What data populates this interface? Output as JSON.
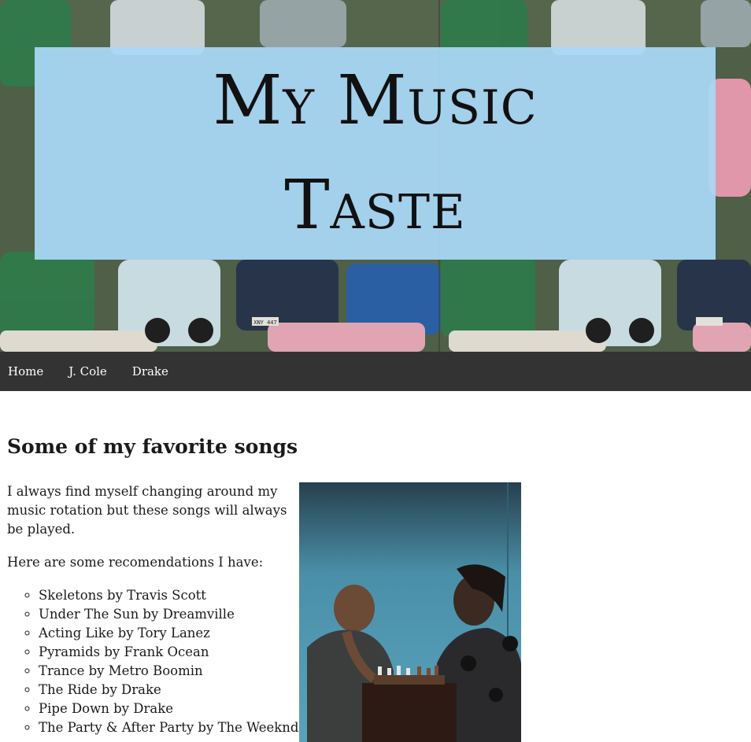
{
  "hero": {
    "title_line1": "My Music",
    "title_line2": "Taste",
    "plate_text": "XNY 447"
  },
  "nav": {
    "items": [
      {
        "label": "Home"
      },
      {
        "label": "J. Cole"
      },
      {
        "label": "Drake"
      }
    ]
  },
  "main": {
    "heading": "Some of my favorite songs",
    "intro": "I always find myself changing around my music rotation but these songs will always be played.",
    "recs_intro": "Here are some recomendations I have:",
    "songs": [
      "Skeletons by Travis Scott",
      "Under The Sun by Dreamville",
      "Acting Like by Tory Lanez",
      "Pyramids by Frank Ocean",
      "Trance by Metro Boomin",
      "The Ride by Drake",
      "Pipe Down by Drake",
      "The Party & After Party by The Weeknd"
    ]
  },
  "colors": {
    "nav_bg": "#333333",
    "title_box": "#aad8f8",
    "photo_bg": "#4d8fa8"
  }
}
